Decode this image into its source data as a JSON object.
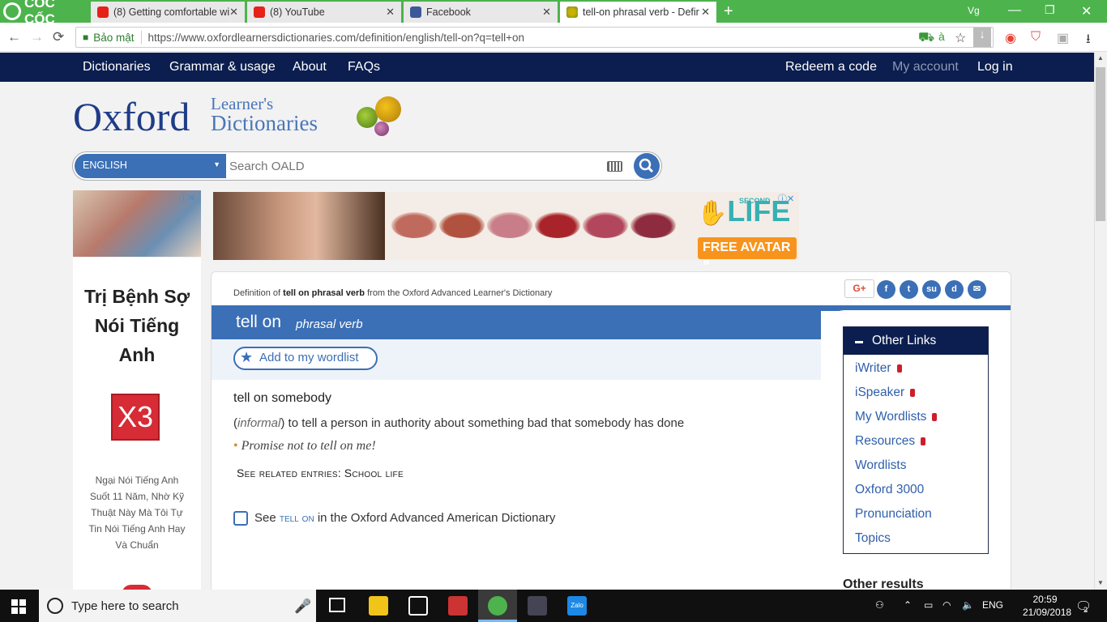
{
  "browser": {
    "brand": "CỐC CỐC",
    "tabs": [
      {
        "title": "(8) Getting comfortable wi",
        "icon": "youtube-icon"
      },
      {
        "title": "(8) YouTube",
        "icon": "youtube-icon"
      },
      {
        "title": "Facebook",
        "icon": "facebook-icon"
      },
      {
        "title": "tell-on phrasal verb - Defir",
        "icon": "oxford-icon",
        "active": true
      }
    ],
    "profile": "Vg",
    "secure_label": "Bảo mật",
    "url": "https://www.oxfordlearnersdictionaries.com/definition/english/tell-on?q=tell+on"
  },
  "site_nav": {
    "left": [
      "Dictionaries",
      "Grammar & usage",
      "About",
      "FAQs"
    ],
    "right": [
      "Redeem a code",
      "My account",
      "Log in"
    ]
  },
  "logo": {
    "oxford": "Oxford",
    "learners": "Learner's",
    "dictionaries": "Dictionaries"
  },
  "search": {
    "language": "ENGLISH",
    "placeholder": "Search OALD"
  },
  "ads": {
    "second_life_logo": "LIFE",
    "second_life_top": "SECOND",
    "second_life_cta": "FREE AVATAR",
    "side_title": "Trị Bệnh Sợ Nói Tiếng Anh",
    "side_badge": "X3",
    "side_desc": "Ngại Nói Tiếng Anh Suốt 11 Năm, Nhờ Kỹ Thuật Này Mà Tôi Tự Tin Nói Tiếng Anh Hay Và Chuẩn",
    "lip_colors": [
      "#c06a5e",
      "#b0523f",
      "#c87d89",
      "#a8242a",
      "#b2465c",
      "#8e2b3f"
    ]
  },
  "entry": {
    "definition_of_prefix": "Definition of",
    "definition_of_word": "tell on phrasal verb",
    "definition_of_suffix": "from the Oxford Advanced Learner's Dictionary",
    "headword": "tell on",
    "pos": "phrasal verb",
    "wordlist_button": "Add to my wordlist",
    "sense_head": "tell on somebody",
    "label": "informal",
    "definition": "to tell a person in authority about something bad that somebody has done",
    "example": "Promise not to tell on me!",
    "related_prefix": "See related entries:",
    "related_link": "School life",
    "see_prefix": "See",
    "see_word": "tell on",
    "see_suffix": "in the Oxford Advanced American Dictionary"
  },
  "share": {
    "gplus": "G+",
    "icons": [
      "facebook-icon",
      "twitter-icon",
      "stumbleupon-icon",
      "digg-icon",
      "email-icon"
    ]
  },
  "other_links": {
    "title": "Other Links",
    "items": [
      {
        "label": "iWriter",
        "locked": true
      },
      {
        "label": "iSpeaker",
        "locked": true
      },
      {
        "label": "My Wordlists",
        "locked": true
      },
      {
        "label": "Resources",
        "locked": true
      },
      {
        "label": "Wordlists",
        "locked": false
      },
      {
        "label": "Oxford 3000",
        "locked": false
      },
      {
        "label": "Pronunciation",
        "locked": false
      },
      {
        "label": "Topics",
        "locked": false
      }
    ],
    "other_results": "Other results"
  },
  "taskbar": {
    "search_placeholder": "Type here to search",
    "language": "ENG",
    "time": "20:59",
    "date": "21/09/2018",
    "notifications": "2"
  }
}
